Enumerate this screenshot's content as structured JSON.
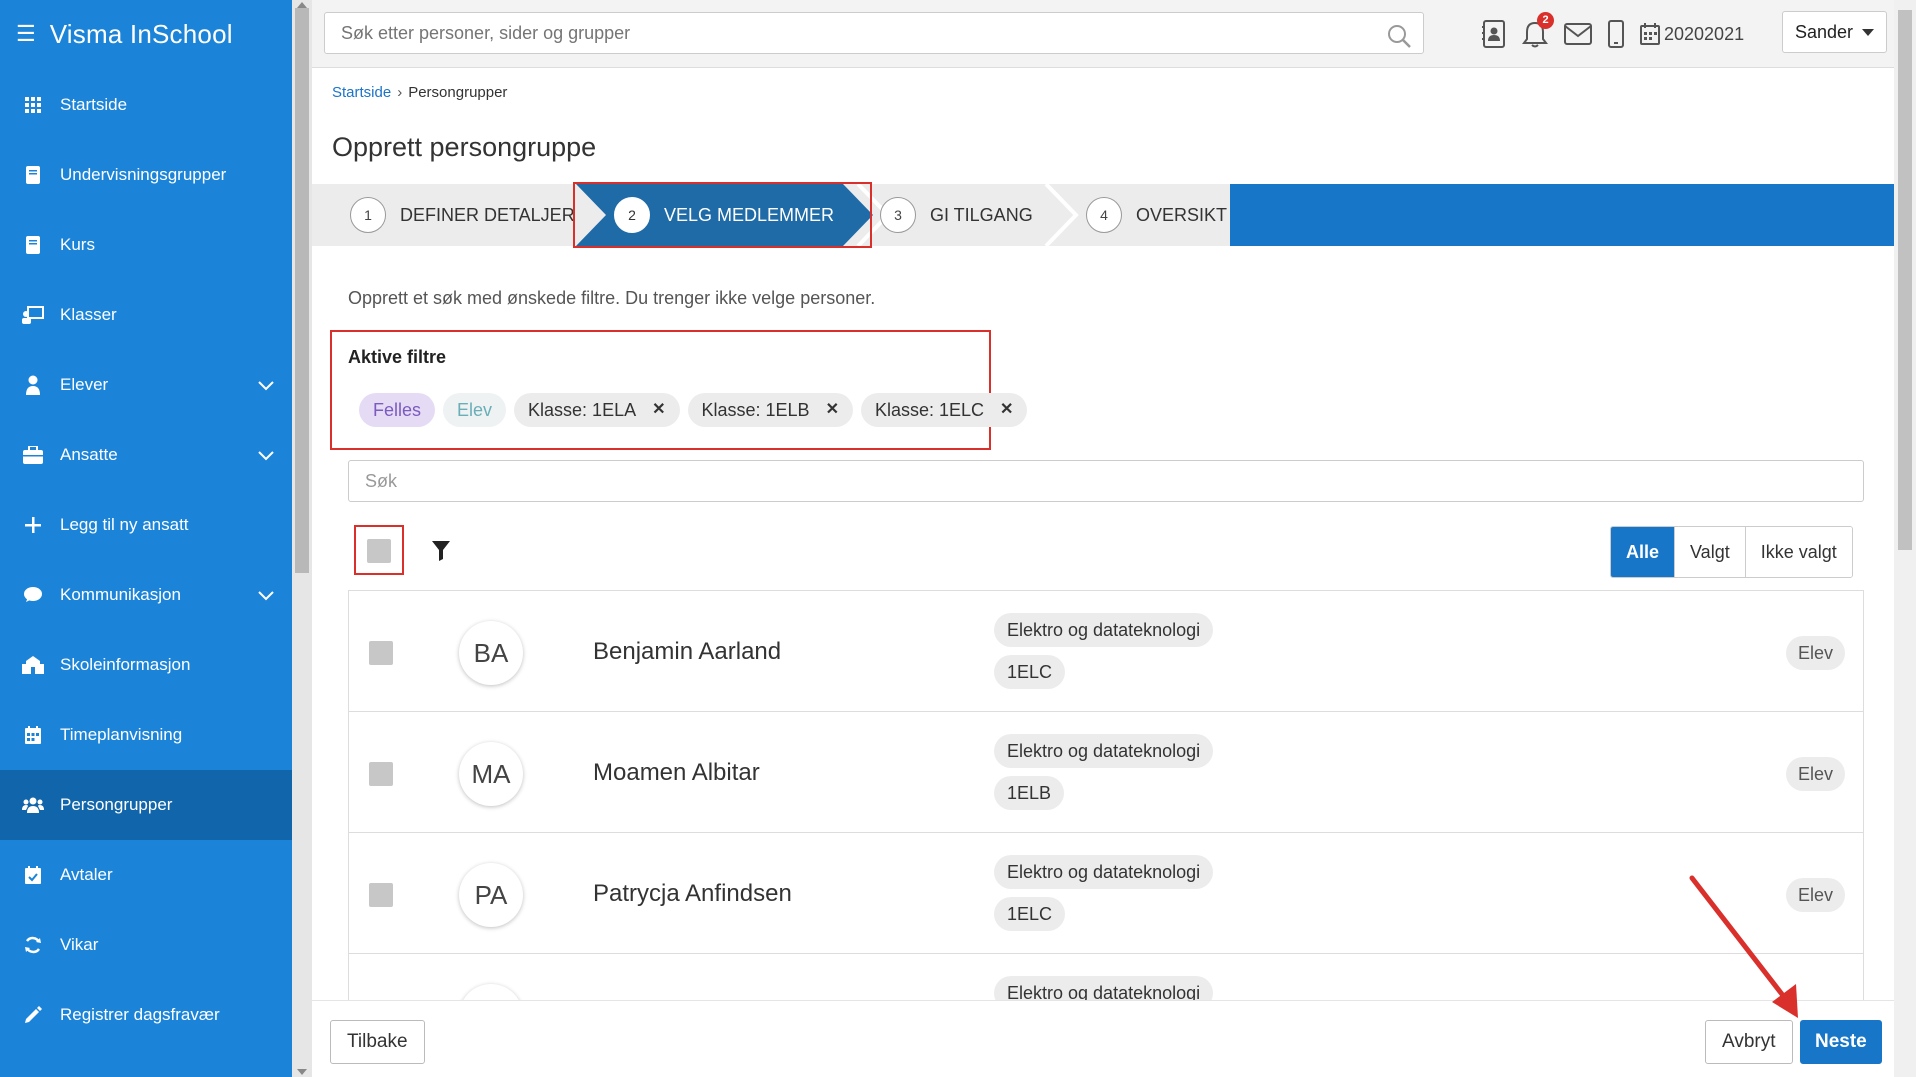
{
  "app": {
    "title": "Visma InSchool"
  },
  "sidebar": {
    "items": [
      {
        "label": "Startside",
        "icon": "grid-icon"
      },
      {
        "label": "Undervisningsgrupper",
        "icon": "book-icon"
      },
      {
        "label": "Kurs",
        "icon": "book-icon"
      },
      {
        "label": "Klasser",
        "icon": "classroom-icon"
      },
      {
        "label": "Elever",
        "icon": "student-icon",
        "expandable": true
      },
      {
        "label": "Ansatte",
        "icon": "briefcase-icon",
        "expandable": true
      },
      {
        "label": "Legg til ny ansatt",
        "icon": "plus-icon"
      },
      {
        "label": "Kommunikasjon",
        "icon": "chat-icon",
        "expandable": true
      },
      {
        "label": "Skoleinformasjon",
        "icon": "school-icon"
      },
      {
        "label": "Timeplanvisning",
        "icon": "calendar-icon"
      },
      {
        "label": "Persongrupper",
        "icon": "people-icon",
        "active": true
      },
      {
        "label": "Avtaler",
        "icon": "calendar-check-icon"
      },
      {
        "label": "Vikar",
        "icon": "refresh-icon"
      },
      {
        "label": "Registrer dagsfravær",
        "icon": "pencil-icon"
      }
    ]
  },
  "topbar": {
    "search_placeholder": "Søk etter personer, sider og grupper",
    "notification_count": "2",
    "school_year": "20202021",
    "user": "Sander"
  },
  "breadcrumb": {
    "home": "Startside",
    "current": "Persongrupper"
  },
  "page": {
    "title": "Opprett persongruppe"
  },
  "steps": [
    {
      "num": "1",
      "label": "DEFINER DETALJER"
    },
    {
      "num": "2",
      "label": "VELG MEDLEMMER",
      "active": true
    },
    {
      "num": "3",
      "label": "GI TILGANG"
    },
    {
      "num": "4",
      "label": "OVERSIKT"
    }
  ],
  "hint": "Opprett et søk med ønskede filtre. Du trenger ikke velge personer.",
  "filters": {
    "title": "Aktive filtre",
    "chips": [
      {
        "label": "Felles"
      },
      {
        "label": "Elev"
      },
      {
        "label": "Klasse: 1ELA"
      },
      {
        "label": "Klasse: 1ELB"
      },
      {
        "label": "Klasse: 1ELC"
      }
    ]
  },
  "list_search": {
    "placeholder": "Søk"
  },
  "view_toggle": {
    "options": [
      "Alle",
      "Valgt",
      "Ikke valgt"
    ],
    "selected": "Alle"
  },
  "people": [
    {
      "initials": "BA",
      "name": "Benjamin Aarland",
      "program": "Elektro og datateknologi",
      "class": "1ELC",
      "role": "Elev"
    },
    {
      "initials": "MA",
      "name": "Moamen Albitar",
      "program": "Elektro og datateknologi",
      "class": "1ELB",
      "role": "Elev"
    },
    {
      "initials": "PA",
      "name": "Patrycja Anfindsen",
      "program": "Elektro og datateknologi",
      "class": "1ELC",
      "role": "Elev"
    },
    {
      "initials": "",
      "name": "",
      "program": "Elektro og datateknologi",
      "class": "",
      "role": ""
    }
  ],
  "footer": {
    "back": "Tilbake",
    "cancel": "Avbryt",
    "next": "Neste"
  },
  "colors": {
    "sidebar": "#1b84d8",
    "sidebar_active": "#1165aa",
    "primary": "#1776c8",
    "highlight": "#d9302c"
  }
}
